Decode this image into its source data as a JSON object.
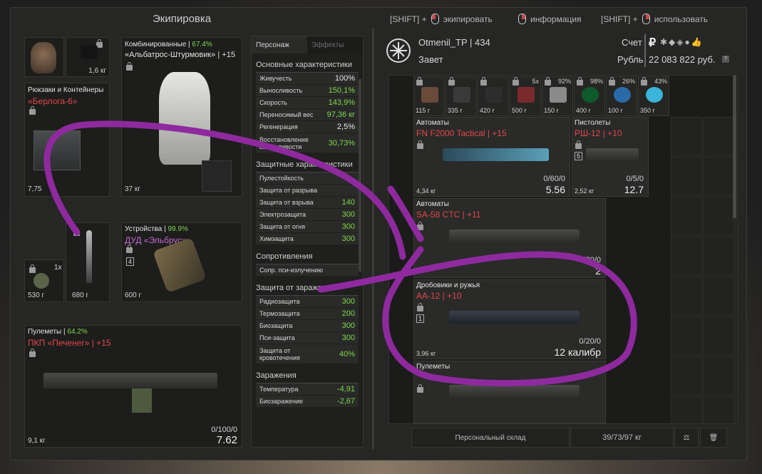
{
  "title": "Экипировка",
  "hints": [
    {
      "key": "[SHIFT] +",
      "mouse": "left",
      "label": "экипировать"
    },
    {
      "key": "",
      "mouse": "right",
      "label": "информация"
    },
    {
      "key": "[SHIFT] +",
      "mouse": "right",
      "label": "использовать"
    }
  ],
  "equipment": {
    "helmet_weight": "1,6 кг",
    "backpack_label": "Рюкзаки и Контейнеры",
    "backpack_name": "«Берлога-6»",
    "backpack_weight": "7,75",
    "armor_label": "Комбинированные",
    "armor_pct": "67.4%",
    "armor_name": "«Альбатрос-Штурмовик»",
    "armor_upgrade": "+15",
    "armor_weight": "37 кг",
    "grenade_count": "1x",
    "grenade_weight": "530 г",
    "knife_weight": "680 г",
    "device_label": "Устройства",
    "device_pct": "99.9%",
    "device_name": "ДУД «Эльбрус»",
    "device_slots": "4",
    "device_weight": "600 г",
    "mg_label": "Пулеметы",
    "mg_pct": "64.2%",
    "mg_name": "ПКП «Печенег»",
    "mg_upgrade": "+15",
    "mg_weight": "9,1 кг",
    "mg_ammo": "0/100/0",
    "mg_caliber": "7.62"
  },
  "stats": {
    "tab_character": "Персонаж",
    "tab_effects": "Эффекты",
    "sections": [
      {
        "title": "Основные характеристики",
        "rows": [
          {
            "name": "Живучесть",
            "value": "100%",
            "color": "white"
          },
          {
            "name": "Выносливость",
            "value": "150,1%",
            "color": "g"
          },
          {
            "name": "Скорость",
            "value": "143,9%",
            "color": "g"
          },
          {
            "name": "Переносимый вес",
            "value": "97,36 кг",
            "color": "g"
          },
          {
            "name": "Регенерация",
            "value": "2,5%",
            "color": "white"
          },
          {
            "name": "Восстановление выносливости",
            "value": "30,73%",
            "color": "g",
            "tall": true
          }
        ]
      },
      {
        "title": "Защитные характеристики",
        "rows": [
          {
            "name": "Пулестойкость",
            "value": "",
            "color": "g"
          },
          {
            "name": "Защита от разрыва",
            "value": "",
            "color": "g"
          },
          {
            "name": "Защита от взрыва",
            "value": "140",
            "color": "g"
          },
          {
            "name": "Электрозащита",
            "value": "300",
            "color": "g"
          },
          {
            "name": "Защита от огня",
            "value": "300",
            "color": "g"
          },
          {
            "name": "Химзащита",
            "value": "300",
            "color": "g"
          }
        ]
      },
      {
        "title": "Сопротивления",
        "rows": [
          {
            "name": "Сопр. пси-излучению",
            "value": "",
            "color": "g"
          }
        ]
      },
      {
        "title": "Защита от заражений",
        "rows": [
          {
            "name": "Радиозащита",
            "value": "300",
            "color": "g"
          },
          {
            "name": "Термозащита",
            "value": "200",
            "color": "g"
          },
          {
            "name": "Биозащита",
            "value": "300",
            "color": "g"
          },
          {
            "name": "Пси-защита",
            "value": "300",
            "color": "g"
          },
          {
            "name": "Защита от кровотечения",
            "value": "40%",
            "color": "g",
            "tall": true
          }
        ]
      },
      {
        "title": "Заражения",
        "rows": [
          {
            "name": "Температура",
            "value": "-4,91",
            "color": "g"
          },
          {
            "name": "Биозаражение",
            "value": "-2,67",
            "color": "g"
          }
        ]
      }
    ]
  },
  "player": {
    "name": "Otmenil_TP | 434",
    "faction": "Завет",
    "account_label": "Счет",
    "currency_label": "Рубль",
    "money": "22 083 822 руб."
  },
  "stash": {
    "small_items": [
      {
        "weight": "115 г",
        "pct": ""
      },
      {
        "weight": "335 г",
        "pct": ""
      },
      {
        "weight": "420 г",
        "pct": ""
      },
      {
        "weight": "500 г",
        "pct": "5x"
      },
      {
        "weight": "150 г",
        "pct": "92%"
      },
      {
        "weight": "400 г",
        "pct": "98%"
      },
      {
        "weight": "100 г",
        "pct": "26%"
      },
      {
        "weight": "350 г",
        "pct": "43%"
      }
    ],
    "items": [
      {
        "cat": "Автоматы",
        "name": "FN F2000 Tactical | +15",
        "weight": "4,34 кг",
        "ammo": "0/60/0",
        "cal": "5.56"
      },
      {
        "cat": "Пистолеты",
        "name": "РШ-12 | +10",
        "weight": "2,52 кг",
        "ammo": "0/5/0",
        "cal": "12.7",
        "slots": "5"
      },
      {
        "cat": "Автоматы",
        "name": "SA-58 CTC | +11",
        "weight": "",
        "ammo": "0/30/0",
        "cal": "2"
      },
      {
        "cat": "Дробовики и ружья",
        "name": "АА-12 | +10",
        "weight": "3,96 кг",
        "ammo": "0/20/0",
        "cal": "12 калибр",
        "slots": "1"
      },
      {
        "cat": "Пулеметы",
        "name": "",
        "weight": "",
        "ammo": "",
        "cal": ""
      }
    ],
    "footer_label": "Персональный склад",
    "footer_weight": "39/73/97 кг"
  },
  "colors": {
    "accent_red": "#e04848",
    "green": "#7cd94a",
    "yellow": "#e0c23a",
    "annotation": "#8e2a9e"
  }
}
